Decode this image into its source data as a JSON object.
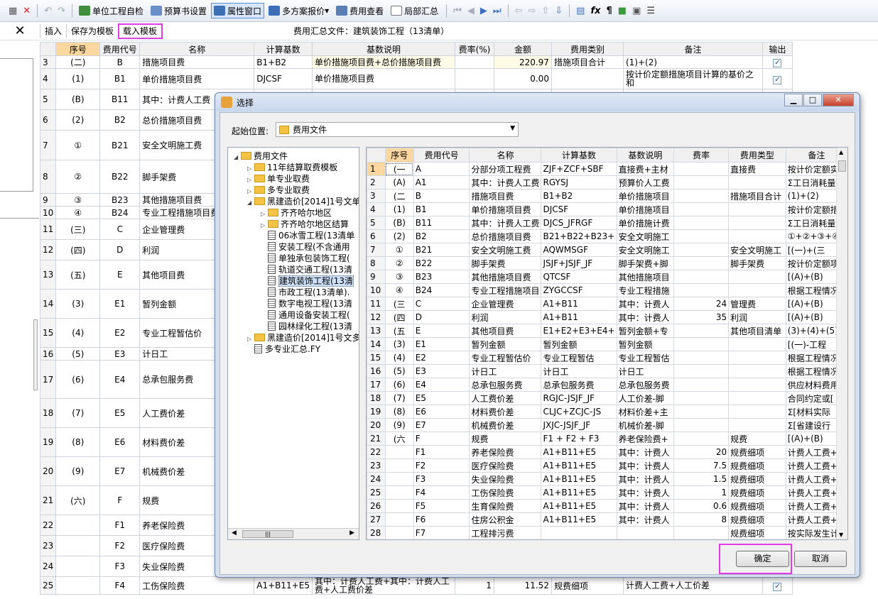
{
  "toolbar": {
    "items": [
      {
        "label": "单位工程自检",
        "icon": "unit-check-icon",
        "color": "#3f8f3f"
      },
      {
        "label": "预算书设置",
        "icon": "gear-icon",
        "color": "#6a8fc8"
      },
      {
        "label": "属性窗口",
        "icon": "property-window-icon",
        "color": "#3c6fb5",
        "active": true
      },
      {
        "label": "多方案报价",
        "icon": "multi-quote-icon",
        "color": "#3c6fb5"
      },
      {
        "label": "费用查看",
        "icon": "fee-view-icon",
        "color": "#5b7fb5"
      },
      {
        "label": "局部汇总",
        "icon": "checkbox-icon",
        "color": "#ffffff"
      }
    ],
    "glyph_fx": "fx",
    "glyph_para": "¶"
  },
  "subbar": {
    "close_glyph": "✕",
    "insert": "插入",
    "save_template": "保存为模板",
    "load_template": "载入模板",
    "title": "费用汇总文件：建筑装饰工程（13清单）"
  },
  "main_grid": {
    "columns": [
      "序号",
      "费用代号",
      "名称",
      "计算基数",
      "基数说明",
      "费率(%)",
      "金额",
      "费用类别",
      "备注",
      "输出"
    ],
    "rows": [
      {
        "rn": "3",
        "seq": "(二)",
        "code": "B",
        "name": "措施项目费",
        "base": "B1+B2",
        "desc": "单价措施项目费+总价措施项目费",
        "rate": "",
        "amount": "220.97",
        "cat": "措施项目合计",
        "note": "(1)+(2)"
      },
      {
        "rn": "4",
        "seq": "(1)",
        "code": "B1",
        "name": "单价措施项目费",
        "base": "DJCSF",
        "desc": "单价措施项目费",
        "rate": "",
        "amount": "0.00",
        "cat": "",
        "note": "按计价定额措施项目计算的基价之和"
      },
      {
        "rn": "5",
        "seq": "(B)",
        "code": "B11",
        "name": "其中：计费人工费",
        "base": "",
        "desc": "",
        "rate": "",
        "amount": "",
        "cat": "",
        "note": ""
      },
      {
        "rn": "6",
        "seq": "(2)",
        "code": "B2",
        "name": "总价措施项目费",
        "base": "",
        "desc": "",
        "rate": "",
        "amount": "",
        "cat": "",
        "note": ""
      },
      {
        "rn": "7",
        "seq": "①",
        "code": "B21",
        "name": "安全文明施工费",
        "base": "",
        "desc": "",
        "rate": "",
        "amount": "",
        "cat": "",
        "note": ""
      },
      {
        "rn": "8",
        "seq": "②",
        "code": "B22",
        "name": "脚手架费",
        "base": "",
        "desc": "",
        "rate": "",
        "amount": "",
        "cat": "",
        "note": ""
      },
      {
        "rn": "9",
        "seq": "③",
        "code": "B23",
        "name": "其他措施项目费",
        "base": "",
        "desc": "",
        "rate": "",
        "amount": "",
        "cat": "",
        "note": ""
      },
      {
        "rn": "10",
        "seq": "④",
        "code": "B24",
        "name": "专业工程措施项目费",
        "base": "",
        "desc": "",
        "rate": "",
        "amount": "",
        "cat": "",
        "note": ""
      },
      {
        "rn": "11",
        "seq": "(三)",
        "code": "C",
        "name": "企业管理费",
        "base": "",
        "desc": "",
        "rate": "",
        "amount": "",
        "cat": "",
        "note": ""
      },
      {
        "rn": "12",
        "seq": "(四)",
        "code": "D",
        "name": "利润",
        "base": "",
        "desc": "",
        "rate": "",
        "amount": "",
        "cat": "",
        "note": ""
      },
      {
        "rn": "13",
        "seq": "(五)",
        "code": "E",
        "name": "其他项目费",
        "base": "",
        "desc": "",
        "rate": "",
        "amount": "",
        "cat": "",
        "note": ""
      },
      {
        "rn": "14",
        "seq": "(3)",
        "code": "E1",
        "name": "暂列金额",
        "base": "",
        "desc": "",
        "rate": "",
        "amount": "",
        "cat": "",
        "note": ""
      },
      {
        "rn": "15",
        "seq": "(4)",
        "code": "E2",
        "name": "专业工程暂估价",
        "base": "",
        "desc": "",
        "rate": "",
        "amount": "",
        "cat": "",
        "note": ""
      },
      {
        "rn": "16",
        "seq": "(5)",
        "code": "E3",
        "name": "计日工",
        "base": "",
        "desc": "",
        "rate": "",
        "amount": "",
        "cat": "",
        "note": ""
      },
      {
        "rn": "17",
        "seq": "(6)",
        "code": "E4",
        "name": "总承包服务费",
        "base": "",
        "desc": "",
        "rate": "",
        "amount": "",
        "cat": "",
        "note": ""
      },
      {
        "rn": "18",
        "seq": "(7)",
        "code": "E5",
        "name": "人工费价差",
        "base": "",
        "desc": "",
        "rate": "",
        "amount": "",
        "cat": "",
        "note": ""
      },
      {
        "rn": "19",
        "seq": "(8)",
        "code": "E6",
        "name": "材料费价差",
        "base": "",
        "desc": "",
        "rate": "",
        "amount": "",
        "cat": "",
        "note": ""
      },
      {
        "rn": "20",
        "seq": "(9)",
        "code": "E7",
        "name": "机械费价差",
        "base": "",
        "desc": "",
        "rate": "",
        "amount": "",
        "cat": "",
        "note": ""
      },
      {
        "rn": "21",
        "seq": "(六)",
        "code": "F",
        "name": "规费",
        "base": "",
        "desc": "",
        "rate": "",
        "amount": "",
        "cat": "",
        "note": ""
      },
      {
        "rn": "22",
        "seq": "",
        "code": "F1",
        "name": "养老保险费",
        "base": "",
        "desc": "",
        "rate": "",
        "amount": "",
        "cat": "",
        "note": ""
      },
      {
        "rn": "23",
        "seq": "",
        "code": "F2",
        "name": "医疗保险费",
        "base": "",
        "desc": "",
        "rate": "",
        "amount": "",
        "cat": "",
        "note": ""
      },
      {
        "rn": "24",
        "seq": "",
        "code": "F3",
        "name": "失业保险费",
        "base": "",
        "desc": "",
        "rate": "",
        "amount": "",
        "cat": "",
        "note": ""
      },
      {
        "rn": "25",
        "seq": "",
        "code": "F4",
        "name": "工伤保险费",
        "base": "A1+B11+E5",
        "desc": "其中：计费人工费+其中：计费人工费+人工费价差",
        "rate": "1",
        "amount": "11.52",
        "cat": "规费细项",
        "note": "计费人工费+人工价差"
      }
    ]
  },
  "dialog": {
    "title": "选择",
    "start_label": "起始位置:",
    "start_value": "费用文件",
    "ok": "确定",
    "cancel": "取消",
    "tree": [
      {
        "label": "费用文件",
        "type": "folder",
        "level": 0,
        "toggle": "◢"
      },
      {
        "label": "11年结算取费模板",
        "type": "folder",
        "level": 1,
        "toggle": "▷"
      },
      {
        "label": "单专业取费",
        "type": "folder",
        "level": 1,
        "toggle": "▷"
      },
      {
        "label": "多专业取费",
        "type": "folder",
        "level": 1,
        "toggle": "▷"
      },
      {
        "label": "黑建造价[2014]1号文单",
        "type": "folder",
        "level": 1,
        "toggle": "◢"
      },
      {
        "label": "齐齐哈尔地区",
        "type": "folder",
        "level": 2,
        "toggle": "▷"
      },
      {
        "label": "齐齐哈尔地区结算",
        "type": "folder",
        "level": 2,
        "toggle": "▷"
      },
      {
        "label": "06冰雪工程(13清单",
        "type": "file",
        "level": 2
      },
      {
        "label": "安装工程(不含通用",
        "type": "file",
        "level": 2
      },
      {
        "label": "单独承包装饰工程(",
        "type": "file",
        "level": 2
      },
      {
        "label": "轨道交通工程(13清",
        "type": "file",
        "level": 2
      },
      {
        "label": "建筑装饰工程(13清",
        "type": "file",
        "level": 2,
        "selected": true
      },
      {
        "label": "市政工程(13清单).",
        "type": "file",
        "level": 2
      },
      {
        "label": "数字电视工程(13清",
        "type": "file",
        "level": 2
      },
      {
        "label": "通用设备安装工程(",
        "type": "file",
        "level": 2
      },
      {
        "label": "园林绿化工程(13清",
        "type": "file",
        "level": 2
      },
      {
        "label": "黑建造价[2014]1号文多",
        "type": "folder",
        "level": 1,
        "toggle": "▷"
      },
      {
        "label": "多专业汇总.FY",
        "type": "file",
        "level": 1
      }
    ],
    "grid_columns": [
      "",
      "序号",
      "费用代号",
      "名称",
      "计算基数",
      "基数说明",
      "费率",
      "费用类型",
      "备注"
    ],
    "grid_rows": [
      {
        "rn": "1",
        "seq": "(一",
        "code": "A",
        "name": "分部分项工程费",
        "base": "ZJF+ZCF+SBF",
        "desc": "直接费+主材",
        "rate": "",
        "type": "直接费",
        "note": "按计价定额实"
      },
      {
        "rn": "2",
        "seq": "(A)",
        "code": "A1",
        "name": "其中：计费人工费",
        "base": "RGYSJ",
        "desc": "预算价人工费",
        "rate": "",
        "type": "",
        "note": "Σ工日消耗量"
      },
      {
        "rn": "3",
        "seq": "(二",
        "code": "B",
        "name": "措施项目费",
        "base": "B1+B2",
        "desc": "单价措施项目",
        "rate": "",
        "type": "措施项目合计",
        "note": "(1)+(2)"
      },
      {
        "rn": "4",
        "seq": "(1)",
        "code": "B1",
        "name": "单价措施项目费",
        "base": "DJCSF",
        "desc": "单价措施项目",
        "rate": "",
        "type": "",
        "note": "按计价定额措"
      },
      {
        "rn": "5",
        "seq": "(B)",
        "code": "B11",
        "name": "其中：计费人工费",
        "base": "DJCS_JFRGF",
        "desc": "单价措施计费",
        "rate": "",
        "type": "",
        "note": "Σ工日消耗量"
      },
      {
        "rn": "6",
        "seq": "(2)",
        "code": "B2",
        "name": "总价措施项目费",
        "base": "B21+B22+B23+",
        "desc": "安全文明施工",
        "rate": "",
        "type": "",
        "note": "①+②+③+④"
      },
      {
        "rn": "7",
        "seq": "①",
        "code": "B21",
        "name": "安全文明施工费",
        "base": "AQWMSGF",
        "desc": "安全文明施工",
        "rate": "",
        "type": "安全文明施工",
        "note": "[(一)+(三"
      },
      {
        "rn": "8",
        "seq": "②",
        "code": "B22",
        "name": "脚手架费",
        "base": "JSJF+JSJF_JF",
        "desc": "脚手架费+脚",
        "rate": "",
        "type": "脚手架费",
        "note": "按计价定额项"
      },
      {
        "rn": "9",
        "seq": "③",
        "code": "B23",
        "name": "其他措施项目费",
        "base": "QTCSF",
        "desc": "其他措施项目",
        "rate": "",
        "type": "",
        "note": "[(A)+(B)"
      },
      {
        "rn": "10",
        "seq": "④",
        "code": "B24",
        "name": "专业工程措施项目",
        "base": "ZYGCCSF",
        "desc": "专业工程措施",
        "rate": "",
        "type": "",
        "note": "根据工程情况"
      },
      {
        "rn": "11",
        "seq": "(三",
        "code": "C",
        "name": "企业管理费",
        "base": "A1+B11",
        "desc": "其中：计费人",
        "rate": "24",
        "type": "管理费",
        "note": "[(A)+(B)"
      },
      {
        "rn": "12",
        "seq": "(四",
        "code": "D",
        "name": "利润",
        "base": "A1+B11",
        "desc": "其中：计费人",
        "rate": "35",
        "type": "利润",
        "note": "[(A)+(B)"
      },
      {
        "rn": "13",
        "seq": "(五",
        "code": "E",
        "name": "其他项目费",
        "base": "E1+E2+E3+E4+",
        "desc": "暂列金额+专",
        "rate": "",
        "type": "其他项目清单",
        "note": "(3)+(4)+(5)+"
      },
      {
        "rn": "14",
        "seq": "(3)",
        "code": "E1",
        "name": "暂列金额",
        "base": "暂列金额",
        "desc": "暂列金额",
        "rate": "",
        "type": "",
        "note": "[(一)-工程"
      },
      {
        "rn": "15",
        "seq": "(4)",
        "code": "E2",
        "name": "专业工程暂估价",
        "base": "专业工程暂估",
        "desc": "专业工程暂估",
        "rate": "",
        "type": "",
        "note": "根据工程情况"
      },
      {
        "rn": "16",
        "seq": "(5)",
        "code": "E3",
        "name": "计日工",
        "base": "计日工",
        "desc": "计日工",
        "rate": "",
        "type": "",
        "note": "根据工程情况"
      },
      {
        "rn": "17",
        "seq": "(6)",
        "code": "E4",
        "name": "总承包服务费",
        "base": "总承包服务费",
        "desc": "总承包服务费",
        "rate": "",
        "type": "",
        "note": "供应材料费用"
      },
      {
        "rn": "18",
        "seq": "(7)",
        "code": "E5",
        "name": "人工费价差",
        "base": "RGJC-JSJF_JF",
        "desc": "人工价差-脚",
        "rate": "",
        "type": "",
        "note": "合同约定或["
      },
      {
        "rn": "19",
        "seq": "(8)",
        "code": "E6",
        "name": "材料费价差",
        "base": "CLJC+ZCJC-JS",
        "desc": "材料价差+主",
        "rate": "",
        "type": "",
        "note": "Σ[材料实际"
      },
      {
        "rn": "20",
        "seq": "(9)",
        "code": "E7",
        "name": "机械费价差",
        "base": "JXJC-JSJF_JF",
        "desc": "机械价差-脚",
        "rate": "",
        "type": "",
        "note": "Σ[省建设行"
      },
      {
        "rn": "21",
        "seq": "(六",
        "code": "F",
        "name": "规费",
        "base": "F1 + F2 + F3",
        "desc": "养老保险费+",
        "rate": "",
        "type": "规费",
        "note": "[(A)+(B)"
      },
      {
        "rn": "22",
        "seq": "",
        "code": "F1",
        "name": "养老保险费",
        "base": "A1+B11+E5",
        "desc": "其中：计费人",
        "rate": "20",
        "type": "规费细项",
        "note": "计费人工费+"
      },
      {
        "rn": "23",
        "seq": "",
        "code": "F2",
        "name": "医疗保险费",
        "base": "A1+B11+E5",
        "desc": "其中：计费人",
        "rate": "7.5",
        "type": "规费细项",
        "note": "计费人工费+"
      },
      {
        "rn": "24",
        "seq": "",
        "code": "F3",
        "name": "失业保险费",
        "base": "A1+B11+E5",
        "desc": "其中：计费人",
        "rate": "1.5",
        "type": "规费细项",
        "note": "计费人工费+"
      },
      {
        "rn": "25",
        "seq": "",
        "code": "F4",
        "name": "工伤保险费",
        "base": "A1+B11+E5",
        "desc": "其中：计费人",
        "rate": "1",
        "type": "规费细项",
        "note": "计费人工费+"
      },
      {
        "rn": "26",
        "seq": "",
        "code": "F5",
        "name": "生育保险费",
        "base": "A1+B11+E5",
        "desc": "其中：计费人",
        "rate": "0.6",
        "type": "规费细项",
        "note": "计费人工费+"
      },
      {
        "rn": "27",
        "seq": "",
        "code": "F6",
        "name": "住房公积金",
        "base": "A1+B11+E5",
        "desc": "其中：计费人",
        "rate": "8",
        "type": "规费细项",
        "note": "计费人工费+"
      },
      {
        "rn": "28",
        "seq": "",
        "code": "F7",
        "name": "工程排污费",
        "base": "",
        "desc": "",
        "rate": "",
        "type": "规费细项",
        "note": "按实际发生计"
      }
    ]
  }
}
